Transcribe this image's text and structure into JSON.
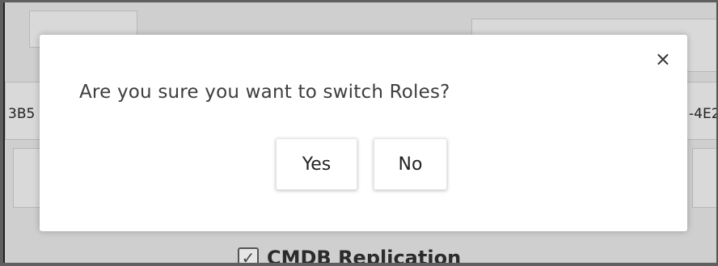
{
  "background": {
    "left_fragment": "3B5",
    "right_fragment": "-4E2",
    "checkbox_label": "CMDB Replication",
    "checkbox_checked": true
  },
  "dialog": {
    "close_icon": "close-icon",
    "close_glyph": "×",
    "message": "Are you sure you want to switch Roles?",
    "yes_label": "Yes",
    "no_label": "No"
  },
  "colors": {
    "overlay": "#cfcfcf",
    "dialog_bg": "#ffffff",
    "text": "#3d3d3d"
  }
}
